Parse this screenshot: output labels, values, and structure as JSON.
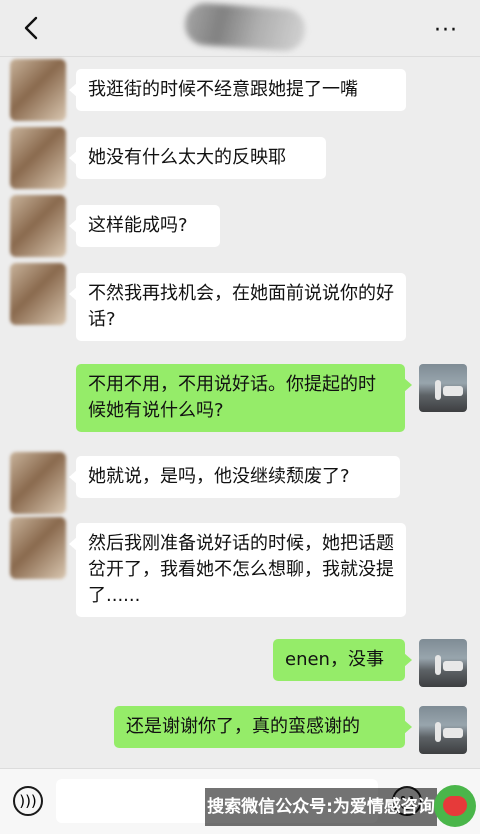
{
  "header": {
    "more_label": "···",
    "back_icon": "chevron-left-icon"
  },
  "messages": [
    {
      "side": "left",
      "text": "我逛街的时候不经意跟她提了一嘴"
    },
    {
      "side": "left",
      "text": "她没有什么太大的反映耶"
    },
    {
      "side": "left",
      "text": "这样能成吗?"
    },
    {
      "side": "left",
      "text": "不然我再找机会，在她面前说说你的好话?"
    },
    {
      "side": "right",
      "text": "不用不用，不用说好话。你提起的时候她有说什么吗?"
    },
    {
      "side": "left",
      "text": "她就说，是吗，他没继续颓废了?"
    },
    {
      "side": "left",
      "text": "然后我刚准备说好话的时候，她把话题岔开了，我看她不怎么想聊，我就没提了......"
    },
    {
      "side": "right",
      "text": "enen，没事"
    },
    {
      "side": "right",
      "text": "还是谢谢你了，真的蛮感谢的"
    }
  ],
  "bottom": {
    "voice_icon": "voice-icon",
    "emoji_icon": "emoji-icon",
    "input_value": ""
  },
  "watermark": {
    "text": "搜索微信公众号:为爱情感咨询"
  },
  "colors": {
    "background": "#ededed",
    "sent_bubble": "#95ec69",
    "received_bubble": "#ffffff"
  }
}
